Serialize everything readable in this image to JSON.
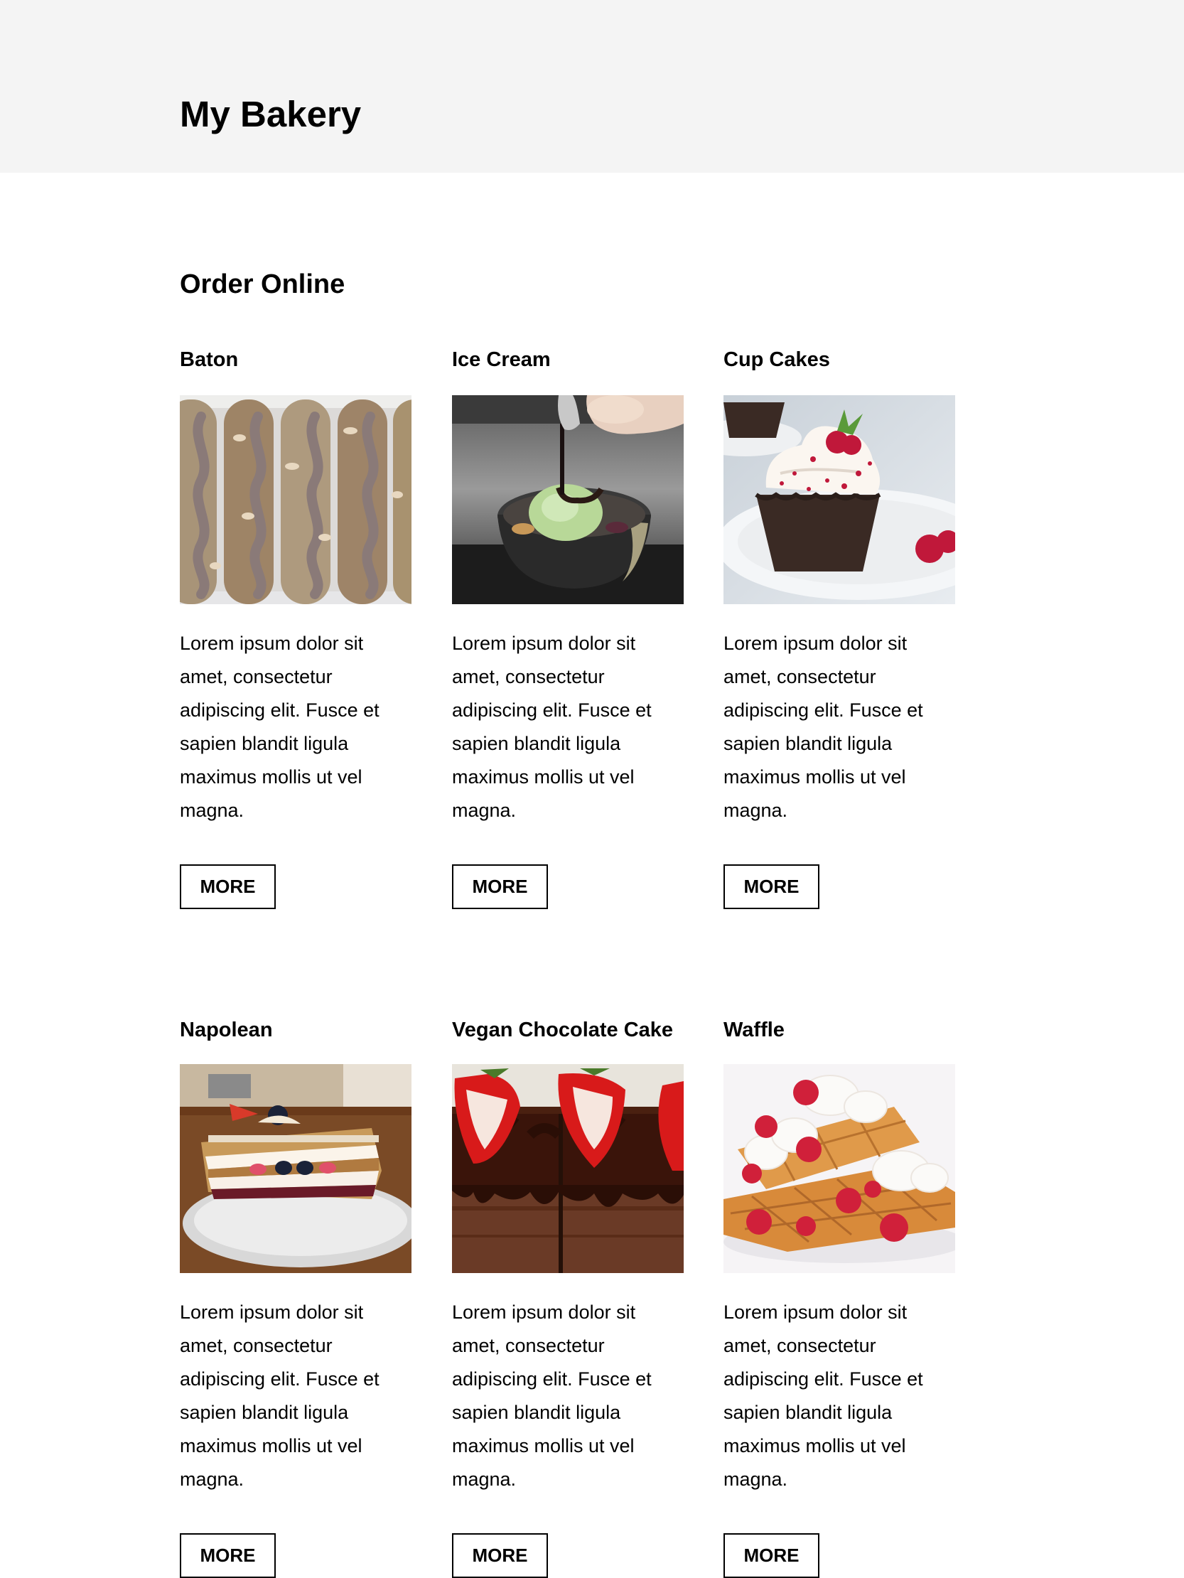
{
  "header": {
    "title": "My Bakery"
  },
  "main": {
    "section_title": "Order Online",
    "products": [
      {
        "title": "Baton",
        "description": "Lorem ipsum dolor sit amet, consectetur adipiscing elit. Fusce et sapien blandit ligula maximus mollis ut vel magna.",
        "button_label": "MORE",
        "image": "baton-photo"
      },
      {
        "title": "Ice Cream",
        "description": "Lorem ipsum dolor sit amet, consectetur adipiscing elit. Fusce et sapien blandit ligula maximus mollis ut vel magna.",
        "button_label": "MORE",
        "image": "ice-cream-photo"
      },
      {
        "title": "Cup Cakes",
        "description": "Lorem ipsum dolor sit amet, consectetur adipiscing elit. Fusce et sapien blandit ligula maximus mollis ut vel magna.",
        "button_label": "MORE",
        "image": "cupcake-photo"
      },
      {
        "title": "Napolean",
        "description": "Lorem ipsum dolor sit amet, consectetur adipiscing elit. Fusce et sapien blandit ligula maximus mollis ut vel magna.",
        "button_label": "MORE",
        "image": "napolean-photo"
      },
      {
        "title": "Vegan Chocolate Cake",
        "description": "Lorem ipsum dolor sit amet, consectetur adipiscing elit. Fusce et sapien blandit ligula maximus mollis ut vel magna.",
        "button_label": "MORE",
        "image": "chocolate-cake-photo"
      },
      {
        "title": "Waffle",
        "description": "Lorem ipsum dolor sit amet, consectetur adipiscing elit. Fusce et sapien blandit ligula maximus mollis ut vel magna.",
        "button_label": "MORE",
        "image": "waffle-photo"
      }
    ]
  }
}
